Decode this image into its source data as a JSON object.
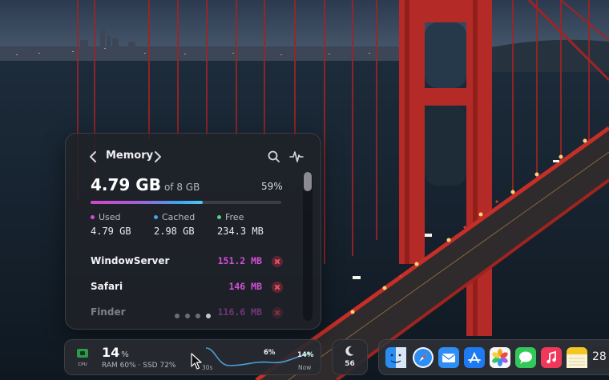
{
  "panel": {
    "title": "Memory",
    "total": "4.79 GB",
    "total_of": "of 8 GB",
    "percent": "59%",
    "usage_fraction": 0.59,
    "legend": [
      {
        "label": "Used",
        "value": "4.79 GB",
        "color": "#d34bd6"
      },
      {
        "label": "Cached",
        "value": "2.98 GB",
        "color": "#3fa6ef"
      },
      {
        "label": "Free",
        "value": "234.3 MB",
        "color": "#4ed37b"
      }
    ],
    "processes": [
      {
        "name": "WindowServer",
        "mem": "151.2 MB"
      },
      {
        "name": "Safari",
        "mem": "146 MB"
      },
      {
        "name": "Finder",
        "mem": "116.6 MB"
      }
    ],
    "page_count": 4,
    "active_page": 3
  },
  "cpu": {
    "chip": "CPU",
    "value": "14",
    "unit": "%",
    "sub": "RAM 60% · SSD 72%",
    "spark_mid": "6%",
    "spark_end": "14%",
    "axis_start": "30s",
    "axis_end": "Now"
  },
  "focus": {
    "value": "56"
  },
  "dock": {
    "apps": [
      "finder-icon",
      "safari-icon",
      "mail-icon",
      "app-store-icon",
      "photos-icon",
      "messages-icon",
      "music-icon",
      "notes-icon"
    ],
    "calendar_day": "28"
  },
  "colors": {
    "accent_magenta": "#d44fd9",
    "accent_blue": "#3fa6ef",
    "accent_green": "#4ed37b"
  }
}
